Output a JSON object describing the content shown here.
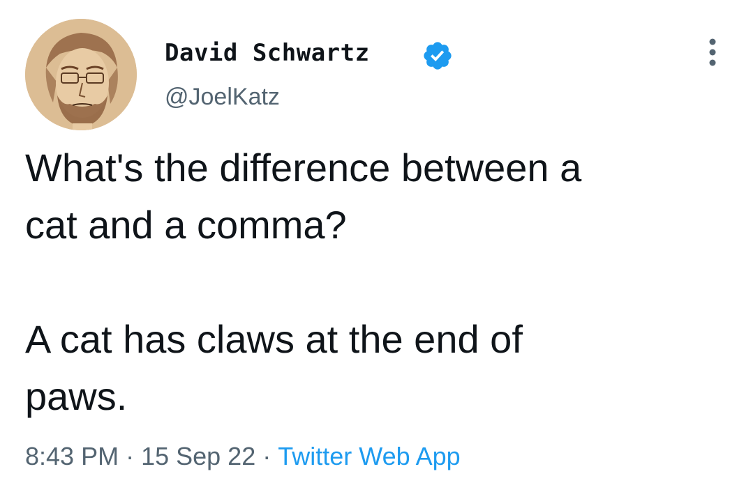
{
  "author": {
    "display_name": "David Schwartz",
    "handle": "@JoelKatz",
    "verified": true,
    "avatar_icon": "sketch-portrait-avatar",
    "verified_icon": "verified-badge-icon",
    "verified_color": "#1d9bf0"
  },
  "tweet": {
    "line1": "What's the difference between a",
    "line2": "cat and a comma?",
    "line3": "A cat has claws at the end of",
    "line4": "paws."
  },
  "meta": {
    "time": "8:43 PM",
    "separator": "·",
    "date": "15 Sep 22",
    "source": "Twitter Web App"
  },
  "more_icon": "more-options-icon",
  "colors": {
    "text": "#0f1419",
    "secondary": "#536471",
    "link": "#1d9bf0",
    "background": "#ffffff"
  }
}
